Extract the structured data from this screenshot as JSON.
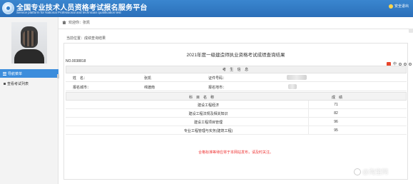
{
  "header": {
    "title": "全国专业技术人员资格考试报名服务平台",
    "subtitle": "Service platform for National Professional and technician qualification test",
    "logout_label": "安全退出"
  },
  "sidebar": {
    "nav_title": "导航菜单",
    "items": [
      {
        "label": "查看考试列表"
      }
    ]
  },
  "main": {
    "welcome": "欢迎你：张凯",
    "breadcrumb": "当前位置：成绩查询结果",
    "doc_title": "2021年度一级建造师执业资格考试成绩查询结果",
    "doc_no": "NO.0038818",
    "toolbar_text": "中",
    "section_title": "考 生 信 息",
    "info": {
      "name_label": "姓　名：",
      "name_value": "张凯",
      "id_label": "证件号码：",
      "city_label": "报名城市：",
      "city_value": "绵渡南",
      "place_label": "报名地市："
    },
    "score_table": {
      "col_subject": "科　目　名　称",
      "col_score": "成　绩",
      "rows": [
        {
          "subject": "建设工程经济",
          "score": "71"
        },
        {
          "subject": "建设工程法规及相关知识",
          "score": "82"
        },
        {
          "subject": "建设工程项目管理",
          "score": "96"
        },
        {
          "subject": "专业工程管理与实务(建筑工程)",
          "score": "95"
        }
      ]
    },
    "note": "合格标准等待应将于本网站发布，请及时关注。"
  },
  "watermark": "@淘宝网"
}
